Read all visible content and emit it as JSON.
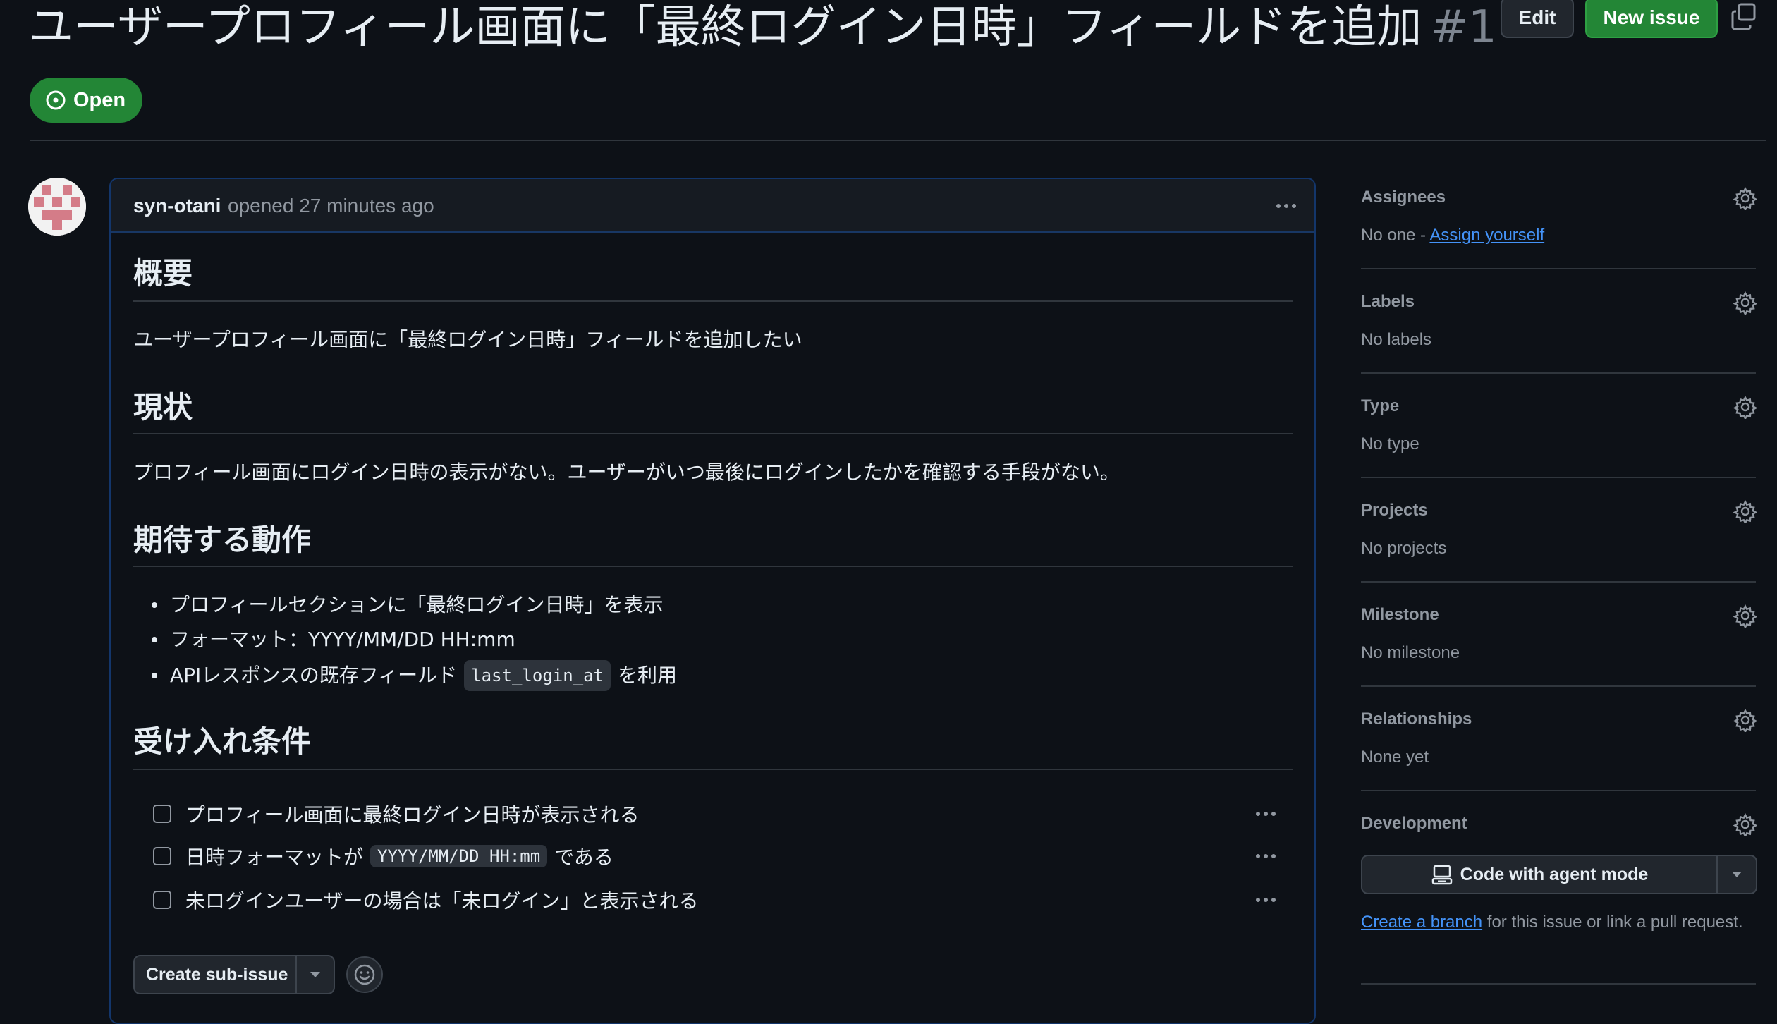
{
  "header": {
    "title": "ユーザープロフィール画面に「最終ログイン日時」フィールドを追加",
    "number": "#1",
    "edit_label": "Edit",
    "new_issue_label": "New issue",
    "status_label": "Open"
  },
  "comment": {
    "author": "syn-otani",
    "meta": "opened 27 minutes ago",
    "sections": {
      "overview": {
        "heading": "概要",
        "text": "ユーザープロフィール画面に「最終ログイン日時」フィールドを追加したい"
      },
      "current": {
        "heading": "現状",
        "text": "プロフィール画面にログイン日時の表示がない。ユーザーがいつ最後にログインしたかを確認する手段がない。"
      },
      "expected": {
        "heading": "期待する動作",
        "item1": "プロフィールセクションに「最終ログイン日時」を表示",
        "item2": "フォーマット：YYYY/MM/DD HH:mm",
        "item3_before": "APIレスポンスの既存フィールド",
        "item3_code": "last_login_at",
        "item3_after": "を利用"
      },
      "acceptance": {
        "heading": "受け入れ条件",
        "task1": "プロフィール画面に最終ログイン日時が表示される",
        "task2_before": "日時フォーマットが",
        "task2_code": "YYYY/MM/DD HH:mm",
        "task2_after": "である",
        "task3": "未ログインユーザーの場合は「未ログイン」と表示される"
      }
    },
    "create_subissue_label": "Create sub-issue"
  },
  "sidebar": {
    "assignees": {
      "title": "Assignees",
      "value_prefix": "No one - ",
      "link": "Assign yourself"
    },
    "labels": {
      "title": "Labels",
      "value": "No labels"
    },
    "type": {
      "title": "Type",
      "value": "No type"
    },
    "projects": {
      "title": "Projects",
      "value": "No projects"
    },
    "milestone": {
      "title": "Milestone",
      "value": "No milestone"
    },
    "relationships": {
      "title": "Relationships",
      "value": "None yet"
    },
    "development": {
      "title": "Development",
      "agent_button": "Code with agent mode",
      "link": "Create a branch",
      "text_after": " for this issue or link a pull request."
    }
  },
  "colors": {
    "background": "#0d1117",
    "accent_green": "#238636",
    "link_blue": "#4493f8",
    "muted": "#9198a1"
  },
  "icons": [
    "copy-icon",
    "issue-opened-icon",
    "kebab-icon",
    "gear-icon",
    "caret-down-icon",
    "smiley-icon",
    "agent-icon"
  ]
}
